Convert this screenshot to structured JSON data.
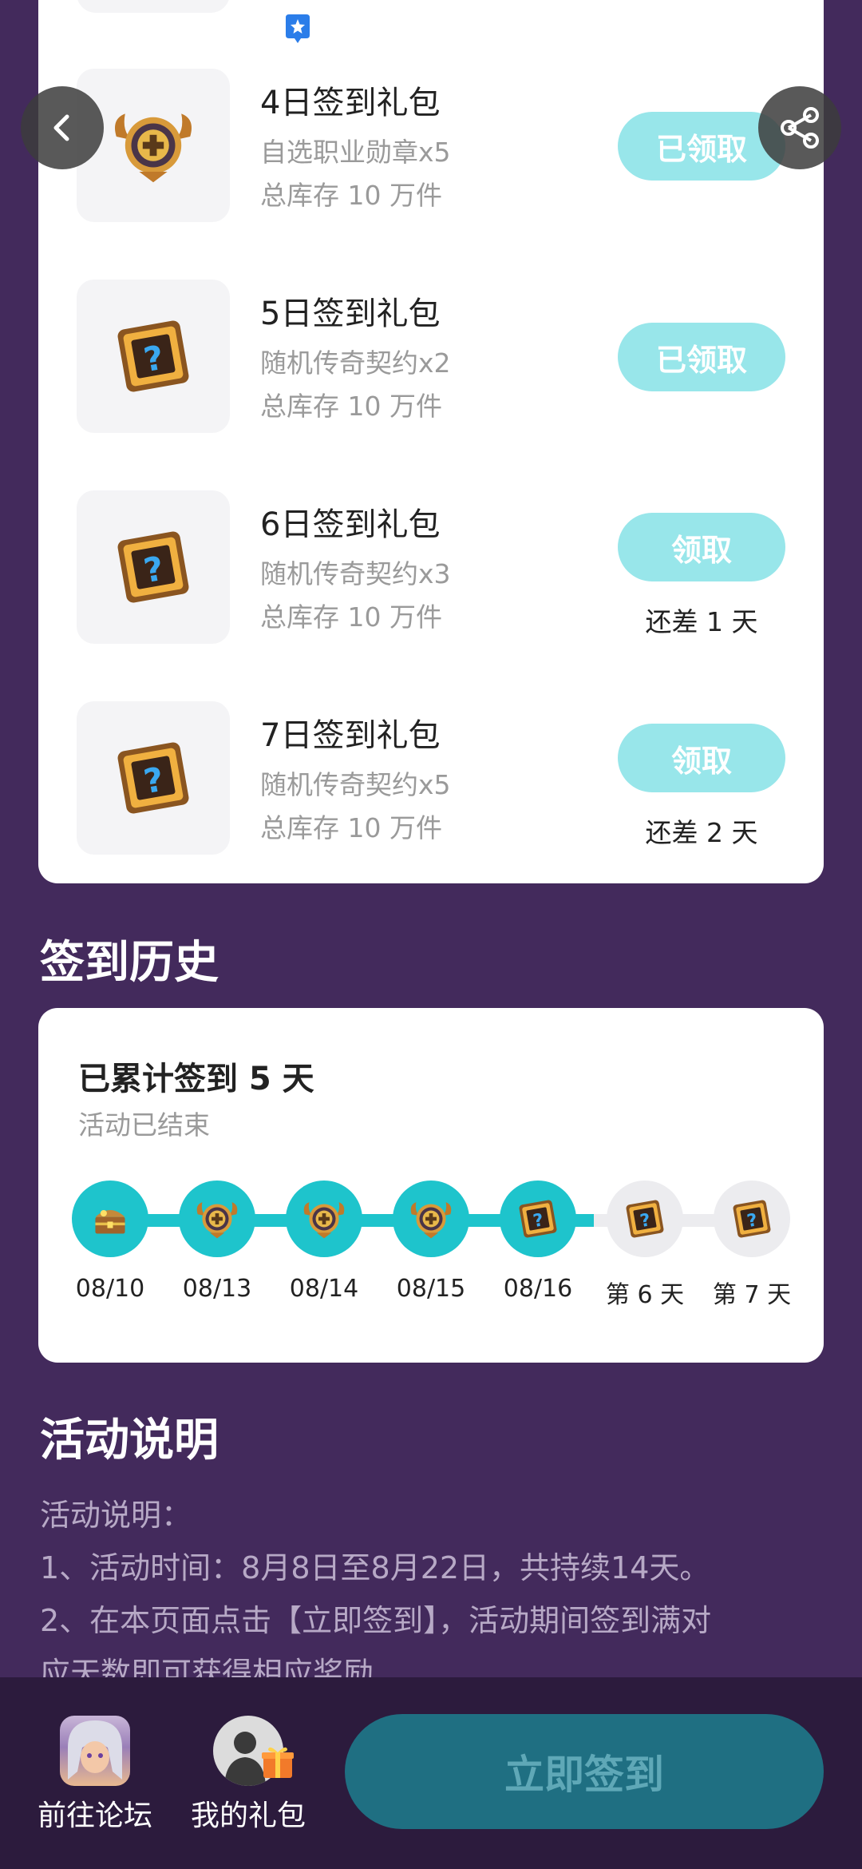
{
  "gifts": [
    {
      "title": "4日签到礼包",
      "desc": "自选职业勋章x5",
      "stock": "总库存 10 万件",
      "button": "已领取",
      "remain": "",
      "icon": "medal-icon"
    },
    {
      "title": "5日签到礼包",
      "desc": "随机传奇契约x2",
      "stock": "总库存 10 万件",
      "button": "已领取",
      "remain": "",
      "icon": "mystery-contract-icon"
    },
    {
      "title": "6日签到礼包",
      "desc": "随机传奇契约x3",
      "stock": "总库存 10 万件",
      "button": "领取",
      "remain": "还差 1 天",
      "icon": "mystery-contract-icon"
    },
    {
      "title": "7日签到礼包",
      "desc": "随机传奇契约x5",
      "stock": "总库存 10 万件",
      "button": "领取",
      "remain": "还差 2 天",
      "icon": "mystery-contract-icon"
    }
  ],
  "history": {
    "section_title": "签到历史",
    "count_text": "已累计签到 5 天",
    "status": "活动已结束",
    "days": [
      {
        "label": "08/10",
        "done": true,
        "icon": "treasure-chest-icon"
      },
      {
        "label": "08/13",
        "done": true,
        "icon": "medal-icon"
      },
      {
        "label": "08/14",
        "done": true,
        "icon": "medal-icon"
      },
      {
        "label": "08/15",
        "done": true,
        "icon": "medal-icon"
      },
      {
        "label": "08/16",
        "done": true,
        "icon": "mystery-contract-icon"
      },
      {
        "label": "第 6 天",
        "done": false,
        "icon": "mystery-contract-icon"
      },
      {
        "label": "第 7 天",
        "done": false,
        "icon": "mystery-contract-icon"
      }
    ]
  },
  "description": {
    "section_title": "活动说明",
    "lines": [
      "活动说明：",
      "1、活动时间：8月8日至8月22日，共持续14天。",
      "2、在本页面点击【立即签到】，活动期间签到满对",
      "应天数即可获得相应奖励"
    ]
  },
  "bottom_nav": {
    "forum_label": "前往论坛",
    "gifts_label": "我的礼包",
    "signin_label": "立即签到"
  },
  "colors": {
    "background": "#432a5c",
    "accent": "#1ec4cc",
    "claim_button": "#98e6ea",
    "signin_button": "#1f6f82"
  }
}
